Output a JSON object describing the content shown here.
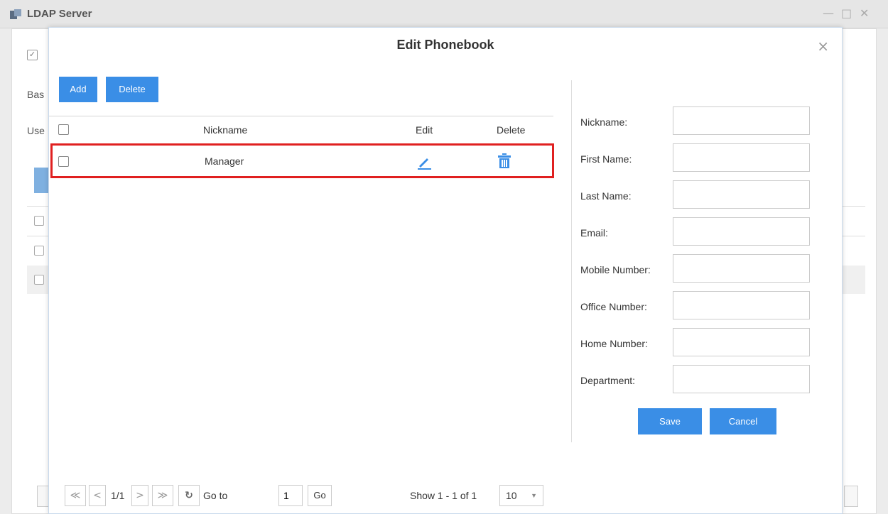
{
  "window": {
    "title": "LDAP Server",
    "controls": {
      "minimize": "—",
      "maximize": "□",
      "close": "✕"
    }
  },
  "background": {
    "labels": [
      "Bas",
      "Use"
    ]
  },
  "modal": {
    "title": "Edit Phonebook",
    "close": "×",
    "toolbar": {
      "add_label": "Add",
      "delete_label": "Delete"
    },
    "table": {
      "headers": {
        "nickname": "Nickname",
        "edit": "Edit",
        "delete": "Delete"
      },
      "rows": [
        {
          "nickname": "Manager",
          "checked": false
        }
      ]
    },
    "form": {
      "fields": [
        {
          "label": "Nickname:",
          "value": ""
        },
        {
          "label": "First Name:",
          "value": ""
        },
        {
          "label": "Last Name:",
          "value": ""
        },
        {
          "label": "Email:",
          "value": ""
        },
        {
          "label": "Mobile Number:",
          "value": ""
        },
        {
          "label": "Office Number:",
          "value": ""
        },
        {
          "label": "Home Number:",
          "value": ""
        },
        {
          "label": "Department:",
          "value": ""
        }
      ],
      "save_label": "Save",
      "cancel_label": "Cancel"
    },
    "pager": {
      "first": "≪",
      "prev": "<",
      "page_info": "1/1",
      "next": ">",
      "last": "≫",
      "refresh": "↻",
      "goto_label": "Go to",
      "goto_value": "1",
      "go_label": "Go",
      "show_text": "Show 1 - 1 of 1",
      "page_size": "10"
    }
  },
  "colors": {
    "accent": "#3a8ee6",
    "highlight_border": "#e02020"
  },
  "icons": {
    "edit": "pencil-icon",
    "delete": "trash-icon",
    "refresh": "refresh-icon"
  }
}
